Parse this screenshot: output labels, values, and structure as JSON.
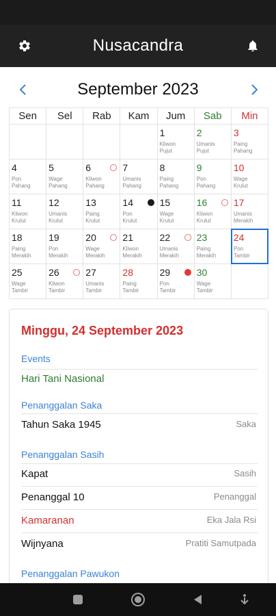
{
  "app": {
    "title": "Nusacandra"
  },
  "calendar": {
    "month_title": "September 2023",
    "weekdays": [
      "Sen",
      "Sel",
      "Rab",
      "Kam",
      "Jum",
      "Sab",
      "Min"
    ],
    "weeks": [
      [
        {
          "day": "",
          "sub1": "",
          "sub2": "",
          "color": "",
          "marker": ""
        },
        {
          "day": "",
          "sub1": "",
          "sub2": "",
          "color": "",
          "marker": ""
        },
        {
          "day": "",
          "sub1": "",
          "sub2": "",
          "color": "",
          "marker": ""
        },
        {
          "day": "",
          "sub1": "",
          "sub2": "",
          "color": "",
          "marker": ""
        },
        {
          "day": "1",
          "sub1": "Kliwon",
          "sub2": "Pujut",
          "color": "",
          "marker": ""
        },
        {
          "day": "2",
          "sub1": "Umanis",
          "sub2": "Pujut",
          "color": "sat",
          "marker": ""
        },
        {
          "day": "3",
          "sub1": "Paing",
          "sub2": "Pahang",
          "color": "sun",
          "marker": ""
        }
      ],
      [
        {
          "day": "4",
          "sub1": "Pon",
          "sub2": "Pahang",
          "color": "",
          "marker": ""
        },
        {
          "day": "5",
          "sub1": "Wage",
          "sub2": "Pahang",
          "color": "",
          "marker": ""
        },
        {
          "day": "6",
          "sub1": "Kliwon",
          "sub2": "Pahang",
          "color": "",
          "marker": "open"
        },
        {
          "day": "7",
          "sub1": "Umanis",
          "sub2": "Pahang",
          "color": "",
          "marker": ""
        },
        {
          "day": "8",
          "sub1": "Paing",
          "sub2": "Pahang",
          "color": "",
          "marker": ""
        },
        {
          "day": "9",
          "sub1": "Pon",
          "sub2": "Pahang",
          "color": "sat",
          "marker": ""
        },
        {
          "day": "10",
          "sub1": "Wage",
          "sub2": "Krulut",
          "color": "sun",
          "marker": ""
        }
      ],
      [
        {
          "day": "11",
          "sub1": "Kliwon",
          "sub2": "Krulut",
          "color": "",
          "marker": ""
        },
        {
          "day": "12",
          "sub1": "Umanis",
          "sub2": "Krulut",
          "color": "",
          "marker": ""
        },
        {
          "day": "13",
          "sub1": "Paing",
          "sub2": "Krulut",
          "color": "",
          "marker": ""
        },
        {
          "day": "14",
          "sub1": "Pon",
          "sub2": "Krulut",
          "color": "",
          "marker": "black"
        },
        {
          "day": "15",
          "sub1": "Wage",
          "sub2": "Krulut",
          "color": "",
          "marker": ""
        },
        {
          "day": "16",
          "sub1": "Kliwon",
          "sub2": "Krulut",
          "color": "sat",
          "marker": "open"
        },
        {
          "day": "17",
          "sub1": "Umanis",
          "sub2": "Merakih",
          "color": "sun",
          "marker": ""
        }
      ],
      [
        {
          "day": "18",
          "sub1": "Paing",
          "sub2": "Merakih",
          "color": "",
          "marker": ""
        },
        {
          "day": "19",
          "sub1": "Pon",
          "sub2": "Merakih",
          "color": "",
          "marker": ""
        },
        {
          "day": "20",
          "sub1": "Wage",
          "sub2": "Merakih",
          "color": "",
          "marker": "open"
        },
        {
          "day": "21",
          "sub1": "Kliwon",
          "sub2": "Merakih",
          "color": "",
          "marker": ""
        },
        {
          "day": "22",
          "sub1": "Umanis",
          "sub2": "Merakih",
          "color": "",
          "marker": "open"
        },
        {
          "day": "23",
          "sub1": "Paing",
          "sub2": "Merakih",
          "color": "sat",
          "marker": ""
        },
        {
          "day": "24",
          "sub1": "Pon",
          "sub2": "Tambir",
          "color": "sun",
          "marker": "",
          "selected": true
        }
      ],
      [
        {
          "day": "25",
          "sub1": "Wage",
          "sub2": "Tambir",
          "color": "",
          "marker": ""
        },
        {
          "day": "26",
          "sub1": "Kliwon",
          "sub2": "Tambir",
          "color": "",
          "marker": "open"
        },
        {
          "day": "27",
          "sub1": "Umanis",
          "sub2": "Tambir",
          "color": "",
          "marker": ""
        },
        {
          "day": "28",
          "sub1": "Paing",
          "sub2": "Tambir",
          "color": "sun",
          "marker": ""
        },
        {
          "day": "29",
          "sub1": "Pon",
          "sub2": "Tambir",
          "color": "",
          "marker": "red"
        },
        {
          "day": "30",
          "sub1": "Wage",
          "sub2": "Tambir",
          "color": "sat",
          "marker": ""
        },
        {
          "day": "",
          "sub1": "",
          "sub2": "",
          "color": "",
          "marker": ""
        }
      ]
    ]
  },
  "detail": {
    "title": "Minggu, 24 September 2023",
    "events_label": "Events",
    "event_name": "Hari Tani Nasional",
    "saka_label": "Penanggalan Saka",
    "saka_rows": [
      {
        "left": "Tahun Saka 1945",
        "right": "Saka"
      }
    ],
    "sasih_label": "Penanggalan Sasih",
    "sasih_rows": [
      {
        "left": "Kapat",
        "right": "Sasih"
      },
      {
        "left": "Penanggal 10",
        "right": "Penanggal"
      },
      {
        "left": "Kamaranan",
        "right": "Eka Jala Rsi"
      },
      {
        "left": "Wijnyana",
        "right": "Pratiti Samutpada"
      }
    ],
    "pawukon_label": "Penanggalan Pawukon"
  },
  "colors": {
    "saturday": "#2e7d32",
    "sunday": "#d32f2f",
    "link_blue": "#3b82d6",
    "selected_border": "#1e6fd9",
    "app_bar": "#222222"
  }
}
